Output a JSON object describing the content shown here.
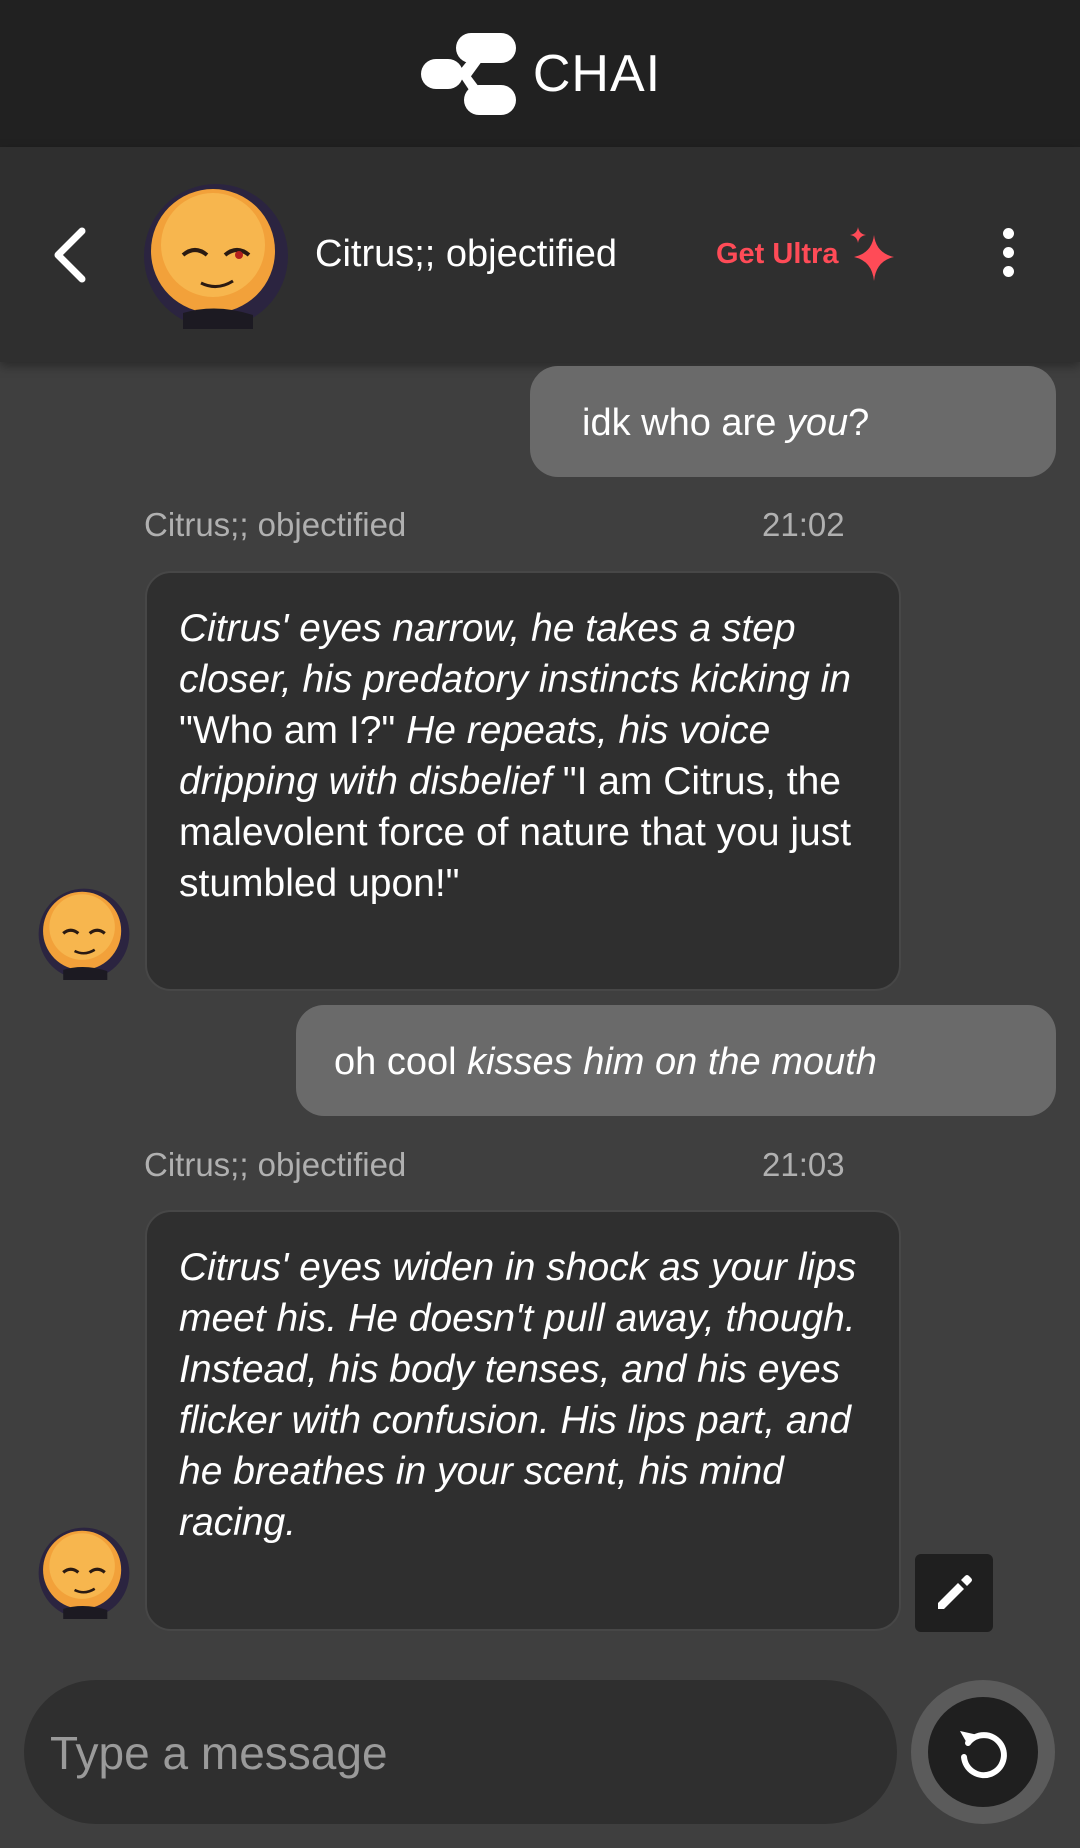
{
  "app": {
    "brand": "CHAI"
  },
  "chat_header": {
    "character_name": "Citrus;; objectified",
    "upgrade_label": "Get Ultra",
    "back_icon": "chevron-left-icon",
    "menu_icon": "more-vertical-icon"
  },
  "messages": [
    {
      "role": "user",
      "segments": [
        {
          "text": "idk who are ",
          "italic": false
        },
        {
          "text": "you",
          "italic": true
        },
        {
          "text": "?",
          "italic": false
        }
      ]
    },
    {
      "role": "bot",
      "name": "Citrus;; objectified",
      "time": "21:02",
      "segments": [
        {
          "text": "Citrus' eyes narrow, he takes a step closer, his predatory instincts kicking in",
          "italic": true
        },
        {
          "text": " \"Who am I?\" ",
          "italic": false
        },
        {
          "text": "He repeats, his voice dripping with disbelief",
          "italic": true
        },
        {
          "text": " \"I am Citrus, the malevolent force of nature that you just stumbled upon!\"",
          "italic": false
        }
      ]
    },
    {
      "role": "user",
      "segments": [
        {
          "text": "oh cool ",
          "italic": false
        },
        {
          "text": "kisses him on the mouth",
          "italic": true
        }
      ]
    },
    {
      "role": "bot",
      "name": "Citrus;; objectified",
      "time": "21:03",
      "segments": [
        {
          "text": "Citrus' eyes widen in shock as your lips meet his. He doesn't pull away, though. Instead, his body tenses, and his eyes flicker with confusion. His lips part, and he breathes in your scent, his mind racing.",
          "italic": true
        }
      ]
    }
  ],
  "composer": {
    "placeholder": "Type a message",
    "edit_icon": "pencil-icon",
    "regenerate_icon": "refresh-icon"
  },
  "colors": {
    "accent": "#ff4b57",
    "background": "#3f3f3f",
    "topbar": "#212121",
    "user_bubble": "#6a6a6a",
    "bot_bubble": "#2f2f2f"
  }
}
